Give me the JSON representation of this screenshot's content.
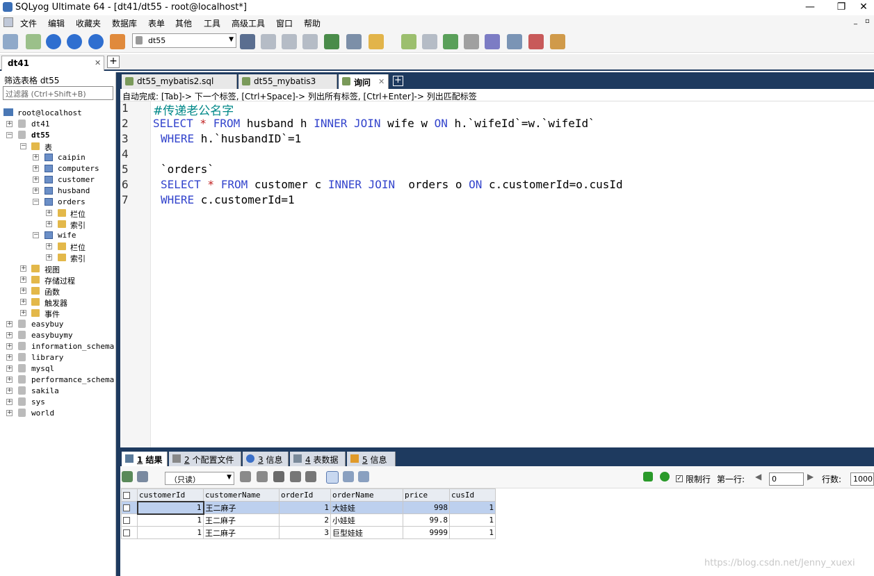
{
  "window": {
    "title": "SQLyog Ultimate 64 - [dt41/dt55 - root@localhost*]",
    "min": "—",
    "max": "❐",
    "close": "✕"
  },
  "menu": [
    "文件",
    "编辑",
    "收藏夹",
    "数据库",
    "表单",
    "其他",
    "工具",
    "高级工具",
    "窗口",
    "帮助"
  ],
  "toolbar": {
    "db_select": "dt55"
  },
  "connection_tab": {
    "label": "dt41",
    "close": "✕",
    "add": "+"
  },
  "sidebar": {
    "title": "筛选表格 dt55",
    "filter_placeholder": "过滤器 (Ctrl+Shift+B)",
    "root": "root@localhost",
    "databases": [
      "dt41",
      "dt55",
      "easybuy",
      "easybuymy",
      "information_schema",
      "library",
      "mysql",
      "performance_schema",
      "sakila",
      "sys",
      "world"
    ],
    "dt55_folders": {
      "tables": "表",
      "views": "视图",
      "procs": "存储过程",
      "funcs": "函数",
      "triggers": "触发器",
      "events": "事件"
    },
    "tables": [
      "caipin",
      "computers",
      "customer",
      "husband",
      "orders",
      "wife"
    ],
    "sub_columns": "栏位",
    "sub_index": "索引"
  },
  "query_tabs": [
    {
      "label": "dt55_mybatis2.sql"
    },
    {
      "label": "dt55_mybatis3"
    },
    {
      "label": "询问",
      "close": "✕"
    }
  ],
  "query_tab_add": "+",
  "hint": "自动完成: [Tab]-> 下一个标签, [Ctrl+Space]-> 列出所有标签, [Ctrl+Enter]-> 列出匹配标签",
  "editor": {
    "line_numbers": [
      "1",
      "2",
      "3",
      "4",
      "5",
      "6",
      "7"
    ],
    "l1": "#传递老公名字",
    "l2": {
      "k1": "SELECT",
      "s1": " * ",
      "k2": "FROM",
      "t1": " husband h ",
      "k3": "INNER JOIN",
      "t2": " wife w ",
      "k4": "ON",
      "t3": " h.`wifeId`=w.`wifeId`"
    },
    "l3": {
      "k1": "WHERE",
      "t1": " h.`husbandID`=1"
    },
    "l5": "`orders`",
    "l6": {
      "k1": "SELECT",
      "s1": " * ",
      "k2": "FROM",
      "t1": " customer c ",
      "k3": "INNER JOIN",
      "t2": "  orders o ",
      "k4": "ON",
      "t3": " c.customerId=o.cusId"
    },
    "l7": {
      "k1": "WHERE",
      "t1": " c.customerId=1"
    }
  },
  "result_tabs": [
    {
      "num": "1",
      "label": " 结果"
    },
    {
      "num": "2",
      "label": " 个配置文件"
    },
    {
      "num": "3",
      "label": " 信息"
    },
    {
      "num": "4",
      "label": " 表数据"
    },
    {
      "num": "5",
      "label": " 信息"
    }
  ],
  "result_toolbar": {
    "mode": "（只读）",
    "limit_label": "限制行",
    "first_row_label": "第一行:",
    "first_row_value": "0",
    "rows_label": "行数:",
    "rows_value": "1000"
  },
  "grid": {
    "columns": [
      "customerId",
      "customerName",
      "orderId",
      "orderName",
      "price",
      "cusId"
    ],
    "rows": [
      [
        "1",
        "王二麻子",
        "1",
        "大娃娃",
        "998",
        "1"
      ],
      [
        "1",
        "王二麻子",
        "2",
        "小娃娃",
        "99.8",
        "1"
      ],
      [
        "1",
        "王二麻子",
        "3",
        "巨型娃娃",
        "9999",
        "1"
      ]
    ]
  },
  "watermark": "https://blog.csdn.net/Jenny_xuexi"
}
